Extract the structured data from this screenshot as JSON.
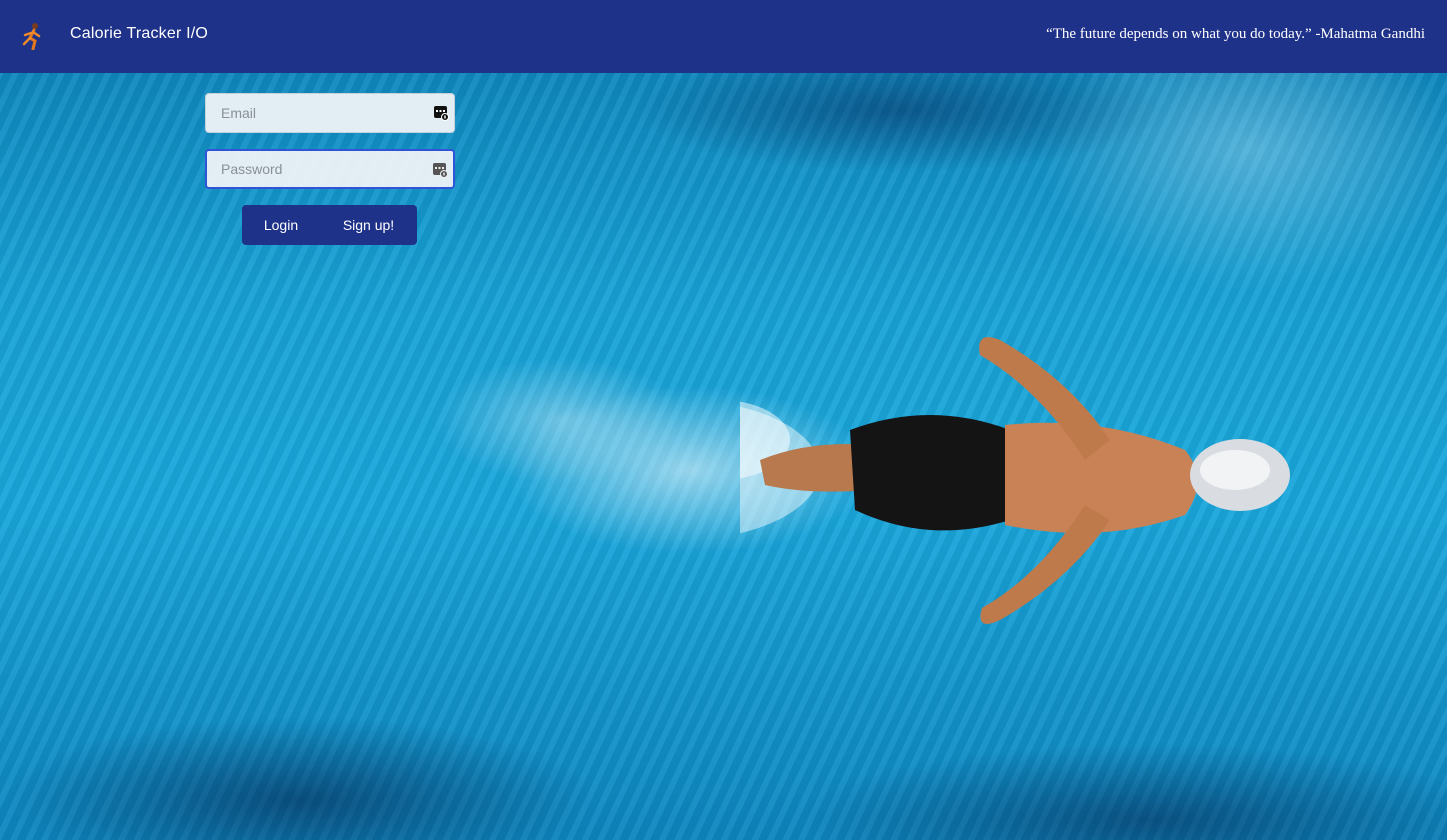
{
  "header": {
    "app_title": "Calorie Tracker I/O",
    "logo_icon": "running-person-icon",
    "quote": "“The future depends on what you do today.” -Mahatma Gandhi",
    "background_color": "#1f3289"
  },
  "login_form": {
    "email": {
      "placeholder": "Email",
      "value": "",
      "icon": "password-manager-key-icon"
    },
    "password": {
      "placeholder": "Password",
      "value": "",
      "icon": "password-manager-key-icon",
      "focused": true
    },
    "login_label": "Login",
    "signup_label": "Sign up!",
    "button_color": "#1f3289",
    "focus_color": "#2f54d8"
  },
  "background": {
    "image": "swimmer-in-pool"
  }
}
